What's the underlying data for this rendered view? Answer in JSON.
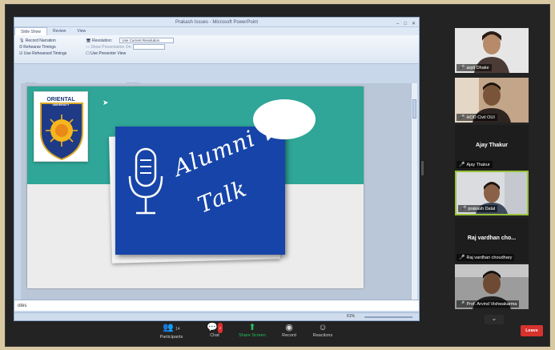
{
  "ppt": {
    "window_title": "Prakash Issues - Microsoft PowerPoint",
    "tabs": [
      "Slide Show",
      "Review",
      "View"
    ],
    "ribbon": {
      "col1": [
        "Record Narration",
        "Rehearse Timings",
        "Use Rehearsed Timings"
      ],
      "col2": [
        "Resolution:",
        "Show Presentation On:",
        "Use Presenter View"
      ],
      "resolution_value": "Use Current Resolution",
      "group_setup": "Set Up",
      "group_monitors": "Monitors"
    },
    "notes_label": "otes",
    "zoom": "61%"
  },
  "slide": {
    "logo_top": "ORIENTAL",
    "logo_sub": "UNIVERSITY",
    "title_line1": "Alumni",
    "title_line2": "Talk"
  },
  "participants": [
    {
      "name": "arpit Dhake",
      "muted": true,
      "video": true,
      "skin": "#b78a6a",
      "bg": "#e6e6e6"
    },
    {
      "name": "HOD Civil OUI",
      "muted": true,
      "video": true,
      "skin": "#7a5438",
      "bg": "#c3a58a"
    },
    {
      "display": "Ajay Thakur",
      "name": "Ajay Thakur",
      "muted": true,
      "video": false
    },
    {
      "name": "prakash Dalal",
      "muted": true,
      "video": true,
      "active": true,
      "skin": "#8a6146",
      "bg": "#dadcdf"
    },
    {
      "display": "Raj vardhan cho...",
      "name": "Raj vardhan choudhary",
      "muted": true,
      "video": false
    },
    {
      "name": "Prof. Arvind Vishwakarma",
      "muted": true,
      "video": true,
      "skin": "#6e4a34",
      "bg": "#9c9c9c"
    }
  ],
  "toolbar": {
    "participants_label": "Participants",
    "participants_count": "14",
    "chat_label": "Chat",
    "chat_badge": "2",
    "share_label": "Share Screen",
    "record_label": "Record",
    "reactions_label": "Reactions",
    "leave_label": "Leave"
  },
  "colors": {
    "zoom_bg": "#232323",
    "slide_teal": "#2fa697",
    "card_blue": "#1744a8",
    "active_speaker": "#9ac23c",
    "share_green": "#27c15b",
    "leave_red": "#d8322e"
  }
}
